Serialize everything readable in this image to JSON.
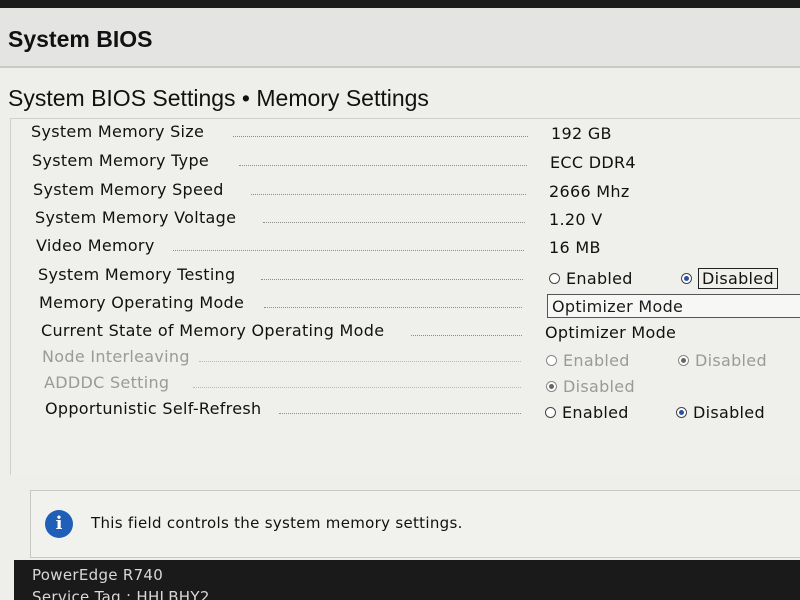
{
  "app": {
    "title": "System BIOS"
  },
  "page": {
    "title": "System BIOS Settings • Memory Settings"
  },
  "settings": [
    {
      "label": "System Memory Size",
      "value": "192 GB"
    },
    {
      "label": "System Memory Type",
      "value": "ECC DDR4"
    },
    {
      "label": "System Memory Speed",
      "value": "2666 Mhz"
    },
    {
      "label": "System Memory Voltage",
      "value": "1.20 V"
    },
    {
      "label": "Video Memory",
      "value": "16 MB"
    },
    {
      "label": "System Memory Testing",
      "options": [
        "Enabled",
        "Disabled"
      ],
      "selected": "Disabled"
    },
    {
      "label": "Memory Operating Mode",
      "value": "Optimizer Mode"
    },
    {
      "label": "Current State of Memory Operating Mode",
      "value": "Optimizer Mode"
    },
    {
      "label": "Node Interleaving",
      "options": [
        "Enabled",
        "Disabled"
      ],
      "selected": "Disabled",
      "disabled": true
    },
    {
      "label": "ADDDC Setting",
      "options": [
        "Disabled"
      ],
      "selected": "Disabled",
      "disabled": true
    },
    {
      "label": "Opportunistic Self-Refresh",
      "options": [
        "Enabled",
        "Disabled"
      ],
      "selected": "Disabled"
    }
  ],
  "help": {
    "icon": "info-icon",
    "text": "This field controls the system memory settings."
  },
  "footer": {
    "model": "PowerEdge R740",
    "service_tag": "Service Tag : HHLBHY2"
  },
  "colors": {
    "accent": "#2a4fa8",
    "info": "#1f5fb8",
    "dim_text": "#9a9a96"
  }
}
